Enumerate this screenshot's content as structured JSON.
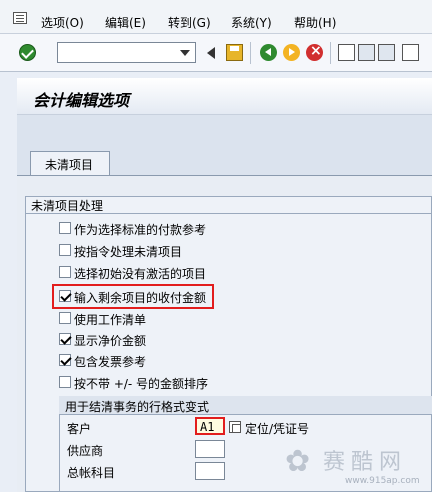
{
  "menu": {
    "items": [
      {
        "label": "选项(O)"
      },
      {
        "label": "编辑(E)"
      },
      {
        "label": "转到(G)"
      },
      {
        "label": "系统(Y)"
      },
      {
        "label": "帮助(H)"
      }
    ]
  },
  "toolbar": {
    "command_field_value": "",
    "icons": [
      "check-icon",
      "back-arrow-icon",
      "save-icon",
      "back-icon",
      "exit-icon",
      "cancel-icon",
      "print-icon",
      "find-icon",
      "find-next-icon",
      "first-page-icon"
    ]
  },
  "title": "会计编辑选项",
  "tab": {
    "label": "未清项目"
  },
  "group": {
    "title": "未清项目处理",
    "options": [
      {
        "label": "作为选择标准的付款参考",
        "checked": false
      },
      {
        "label": "按指令处理未清项目",
        "checked": false
      },
      {
        "label": "选择初始没有激活的项目",
        "checked": false
      },
      {
        "label": "输入剩余项目的收付金额",
        "checked": true
      },
      {
        "label": "使用工作清单",
        "checked": false
      },
      {
        "label": "显示净价金额",
        "checked": true
      },
      {
        "label": "包含发票参考",
        "checked": true
      },
      {
        "label": "按不带 +/- 号的金额排序",
        "checked": false
      }
    ]
  },
  "line_layout": {
    "title": "用于结清事务的行格式变式",
    "fields": [
      {
        "label": "客户",
        "value": "A1"
      },
      {
        "label": "供应商",
        "value": ""
      },
      {
        "label": "总帐科目",
        "value": ""
      }
    ],
    "match_label": "定位/凭证号"
  },
  "watermark": {
    "text": "赛酷网",
    "url": "www.915ap.com"
  },
  "colors": {
    "highlight": "#e21d1d",
    "background": "#e9eef6"
  }
}
